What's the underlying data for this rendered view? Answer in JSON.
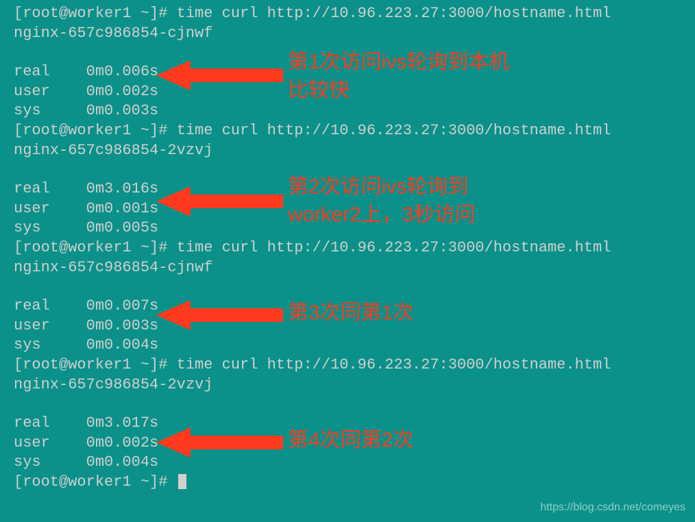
{
  "prompt": "[root@worker1 ~]# ",
  "command": "time curl http://10.96.223.27:3000/hostname.html",
  "runs": [
    {
      "output": "nginx-657c986854-cjnwf",
      "real": "real    0m0.006s",
      "user": "user    0m0.002s",
      "sys": "sys     0m0.003s"
    },
    {
      "output": "nginx-657c986854-2vzvj",
      "real": "real    0m3.016s",
      "user": "user    0m0.001s",
      "sys": "sys     0m0.005s"
    },
    {
      "output": "nginx-657c986854-cjnwf",
      "real": "real    0m0.007s",
      "user": "user    0m0.003s",
      "sys": "sys     0m0.004s"
    },
    {
      "output": "nginx-657c986854-2vzvj",
      "real": "real    0m3.017s",
      "user": "user    0m0.002s",
      "sys": "sys     0m0.004s"
    }
  ],
  "annotations": {
    "a1": "第1次访问ivs轮询到本机\n比较快",
    "a2": "第2次访问ivs轮询到\nworker2上，3秒访问",
    "a3": "第3次同第1次",
    "a4": "第4次同第2次"
  },
  "watermark": "https://blog.csdn.net/comeyes"
}
